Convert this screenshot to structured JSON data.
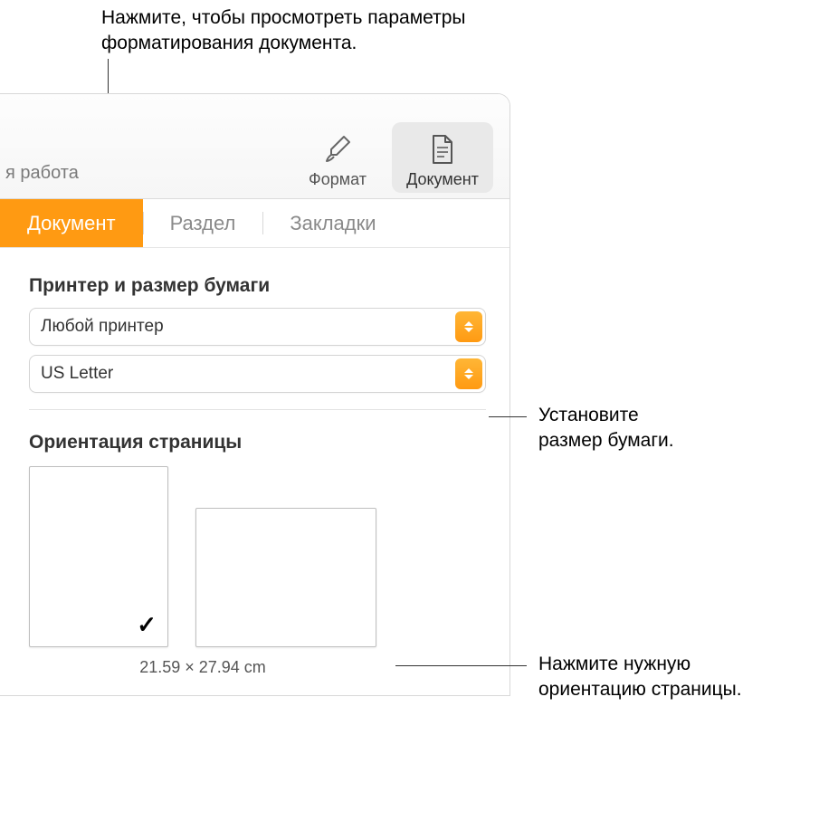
{
  "callouts": {
    "top": "Нажмите, чтобы просмотреть параметры\nформатирования документа.",
    "paper_size": "Установите\nразмер бумаги.",
    "orientation": "Нажмите нужную\nориентацию страницы."
  },
  "toolbar": {
    "left_fragment": "я работа",
    "format_label": "Формат",
    "document_label": "Документ"
  },
  "tabs": {
    "document": "Документ",
    "section": "Раздел",
    "bookmarks": "Закладки"
  },
  "printer_section": {
    "title": "Принтер и размер бумаги",
    "printer_value": "Любой принтер",
    "paper_value": "US Letter"
  },
  "orientation_section": {
    "title": "Ориентация страницы",
    "dimensions": "21.59 × 27.94 cm",
    "checkmark": "✓"
  }
}
